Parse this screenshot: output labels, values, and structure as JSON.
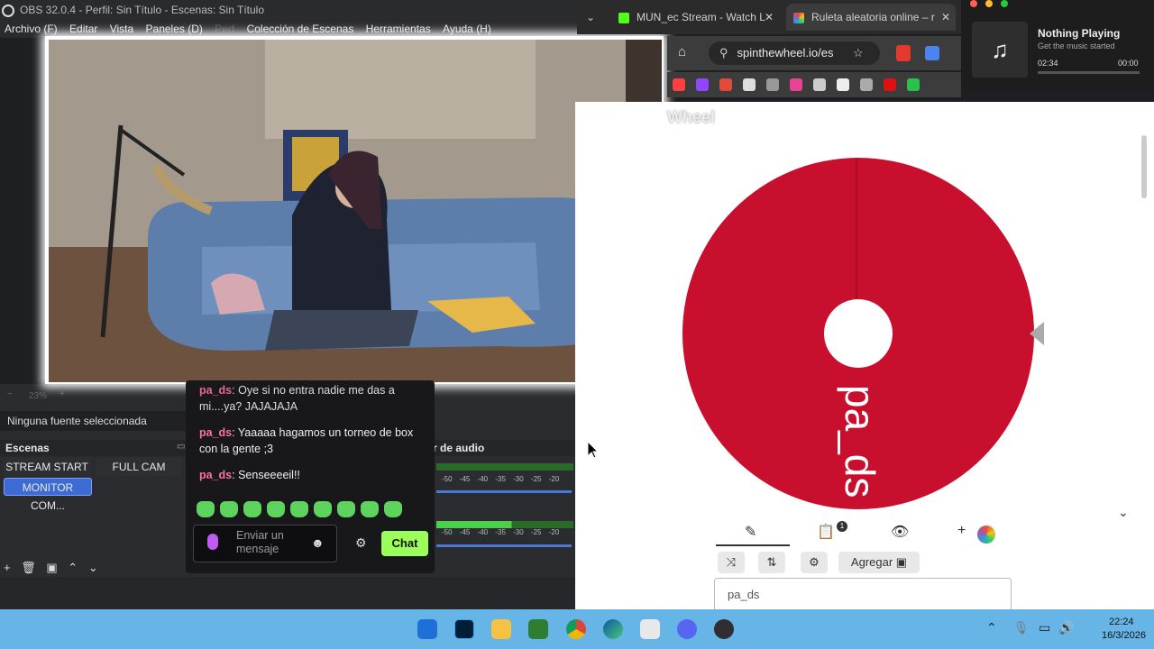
{
  "obs": {
    "title": "OBS 32.0.4 - Perfil: Sin Título - Escenas: Sin Título",
    "menu": [
      "Archivo (F)",
      "Editar",
      "Vista",
      "Paneles (D)",
      "Colección de Escenas",
      "Herramientas",
      "Ayuda (H)"
    ],
    "zoom": "23%",
    "no_source": "Ninguna fuente seleccionada",
    "scenes_title": "Escenas",
    "scenes": [
      "STREAM START",
      "FULL CAM",
      "MONITOR COM..."
    ],
    "audio_title": "r de audio",
    "meter_scale": "-50 -45 -40 -35 -30 -25 -20"
  },
  "chat": {
    "messages": [
      {
        "user": "pa_ds",
        "text": "Oye si no entra nadie me das a mi....ya? JAJAJAJA"
      },
      {
        "user": "pa_ds",
        "text": "Yaaaaa hagamos un torneo de box con la gente ;3"
      },
      {
        "user": "pa_ds",
        "text": "Senseeeeil!!"
      }
    ],
    "placeholder_1": "Enviar un",
    "placeholder_2": "mensaje",
    "button": "Chat"
  },
  "browser": {
    "tabs": [
      {
        "label": "MUN_ec Stream - Watch L",
        "icon": "kick-icon",
        "color": "#53fc18"
      },
      {
        "label": "Ruleta aleatoria online – r",
        "icon": "wheel-icon",
        "color": "#e74c3c"
      }
    ],
    "url": "spinthewheel.io/es",
    "page_logo": "Wheel",
    "wheel": {
      "entries": [
        "pa_ds"
      ],
      "color": "#c8102e"
    },
    "agregar": "Agregar",
    "entry_value": "pa_ds",
    "list_count": "1"
  },
  "media": {
    "title": "Nothing Playing",
    "subtitle": "Get the music started",
    "time_start": "02:34",
    "time_end": "00:00"
  },
  "taskbar": {
    "time": "22:24",
    "date": "16/3/2026"
  }
}
